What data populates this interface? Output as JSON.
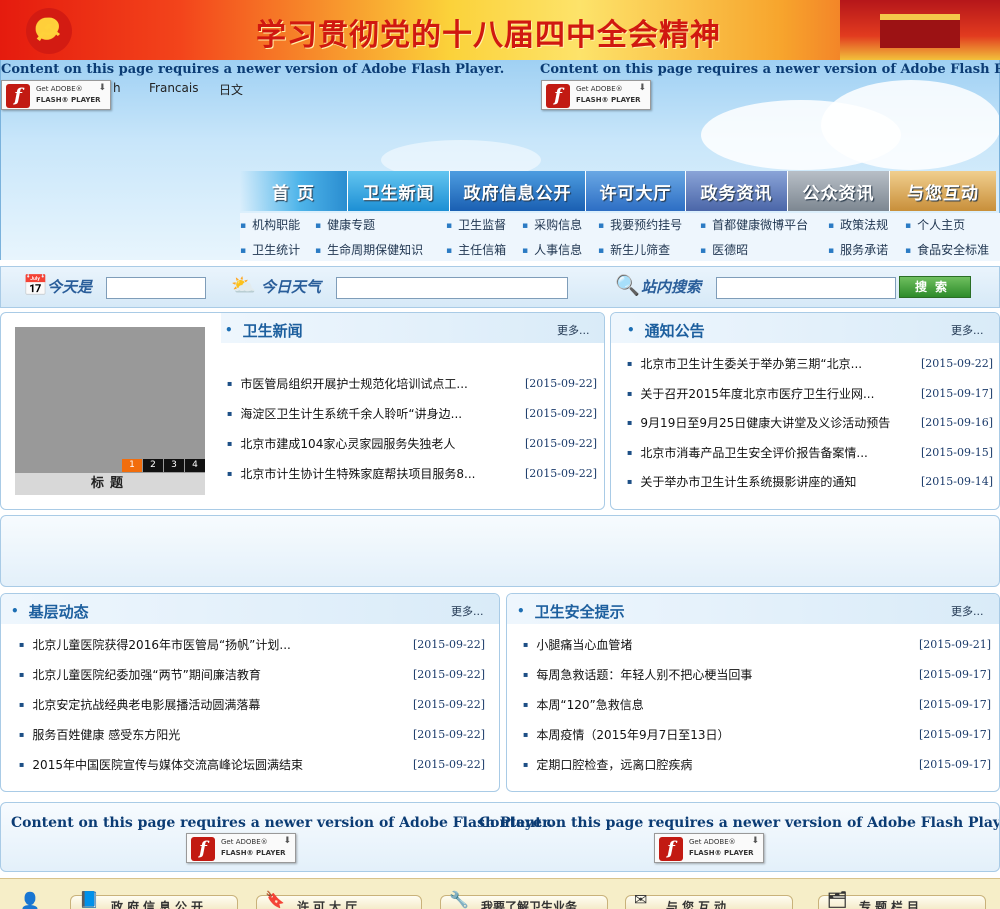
{
  "banner": {
    "title": "学习贯彻党的十八届四中全会精神"
  },
  "flash": {
    "message": "Content on this page requires a newer version of Adobe Flash Player.",
    "button_line1": "Get ADOBE®",
    "button_line2": "FLASH® PLAYER",
    "lang_fragment": "h"
  },
  "languages": [
    "Francais",
    "日文"
  ],
  "nav": {
    "tabs": [
      "首 页",
      "卫生新闻",
      "政府信息公开",
      "许可大厅",
      "政务资讯",
      "公众资讯",
      "与您互动"
    ]
  },
  "subnav": {
    "row1": [
      "机构职能",
      "健康专题",
      "卫生监督",
      "采购信息",
      "我要预约挂号",
      "首都健康微博平台",
      "政策法规",
      "个人主页"
    ],
    "row2": [
      "卫生统计",
      "生命周期保健知识",
      "主任信箱",
      "人事信息",
      "新生儿筛查",
      "医德昭",
      "服务承诺",
      "食品安全标准"
    ]
  },
  "toolbar": {
    "today_label": "今天是",
    "weather_label": "今日天气",
    "search_label": "站内搜索",
    "search_button": "搜索",
    "today_value": "",
    "weather_value": "",
    "search_value": ""
  },
  "slideshow": {
    "pages": [
      "1",
      "2",
      "3",
      "4"
    ],
    "active": 1,
    "caption": "标题"
  },
  "health_news": {
    "title": "卫生新闻",
    "more": "更多...",
    "items": [
      {
        "text": "市医管局组织开展护士规范化培训试点工...",
        "date": "[2015-09-22]"
      },
      {
        "text": "海淀区卫生计生系统千余人聆听“讲身边...",
        "date": "[2015-09-22]"
      },
      {
        "text": "北京市建成104家心灵家园服务失独老人",
        "date": "[2015-09-22]"
      },
      {
        "text": "北京市计生协计生特殊家庭帮扶项目服务8...",
        "date": "[2015-09-22]"
      }
    ]
  },
  "notices": {
    "title": "通知公告",
    "more": "更多...",
    "items": [
      {
        "text": "北京市卫生计生委关于举办第三期“北京...",
        "date": "[2015-09-22]"
      },
      {
        "text": "关于召开2015年度北京市医疗卫生行业网...",
        "date": "[2015-09-17]"
      },
      {
        "text": "9月19日至9月25日健康大讲堂及义诊活动预告",
        "date": "[2015-09-16]"
      },
      {
        "text": "北京市消毒产品卫生安全评价报告备案情...",
        "date": "[2015-09-15]"
      },
      {
        "text": "关于举办市卫生计生系统摄影讲座的通知",
        "date": "[2015-09-14]"
      }
    ]
  },
  "grassroots": {
    "title": "基层动态",
    "more": "更多...",
    "items": [
      {
        "text": "北京儿童医院获得2016年市医管局“扬帆”计划...",
        "date": "[2015-09-22]"
      },
      {
        "text": "北京儿童医院纪委加强“两节”期间廉洁教育",
        "date": "[2015-09-22]"
      },
      {
        "text": "北京安定抗战经典老电影展播活动圆满落幕",
        "date": "[2015-09-22]"
      },
      {
        "text": "服务百姓健康 感受东方阳光",
        "date": "[2015-09-22]"
      },
      {
        "text": "2015年中国医院宣传与媒体交流高峰论坛圆满结束",
        "date": "[2015-09-22]"
      }
    ]
  },
  "safety": {
    "title": "卫生安全提示",
    "more": "更多...",
    "items": [
      {
        "text": "小腿痛当心血管堵",
        "date": "[2015-09-21]"
      },
      {
        "text": "每周急救话题：年轻人别不把心梗当回事",
        "date": "[2015-09-17]"
      },
      {
        "text": "本周“120”急救信息",
        "date": "[2015-09-17]"
      },
      {
        "text": "本周疫情（2015年9月7日至13日）",
        "date": "[2015-09-17]"
      },
      {
        "text": "定期口腔检查，远离口腔疾病",
        "date": "[2015-09-17]"
      }
    ]
  },
  "bottom": {
    "buttons": [
      "政府信息公开",
      "许可大厅",
      "我要了解卫生业务",
      "与您互动",
      "专题栏目"
    ]
  },
  "colors": {
    "brand_blue": "#1d5f9e",
    "banner_red": "#d01810",
    "active_page": "#f26d0c"
  }
}
